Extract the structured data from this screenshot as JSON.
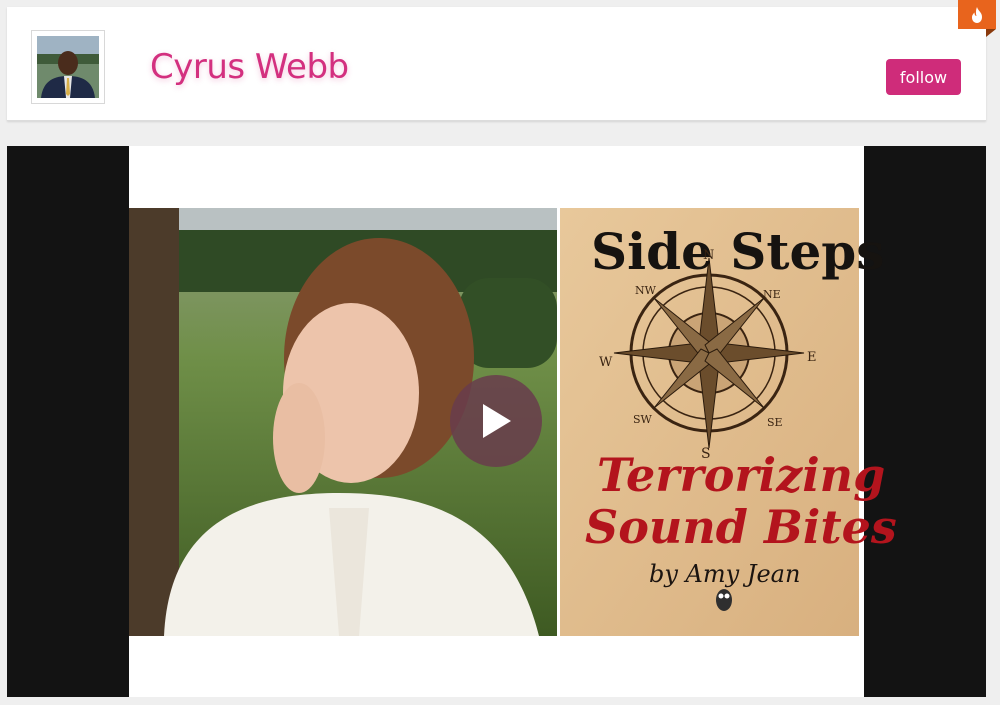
{
  "profile": {
    "name": "Cyrus Webb",
    "follow_label": "follow"
  },
  "badge": {
    "icon": "flame-icon",
    "color": "#e8641d"
  },
  "video": {
    "play_icon": "play-icon",
    "cover": {
      "title_line1": "Side Steps",
      "subtitle_line1": "Terrorizing",
      "subtitle_line2": "Sound Bites",
      "byline": "by Amy Jean",
      "compass_letters": {
        "n": "N",
        "ne": "NE",
        "e": "E",
        "se": "SE",
        "s": "S",
        "sw": "SW",
        "w": "W",
        "nw": "NW"
      }
    }
  },
  "colors": {
    "accent": "#d3307f",
    "button": "#cf2c7a",
    "frame": "#131313"
  }
}
